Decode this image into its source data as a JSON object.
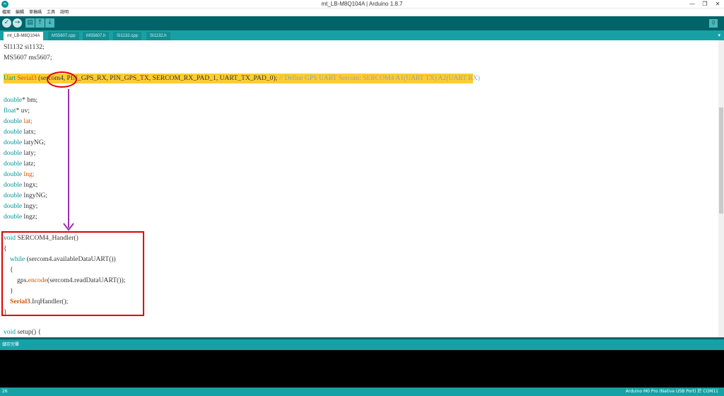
{
  "window": {
    "title": "mt_LB-M8Q104A | Arduino 1.8.7",
    "app_icon": "arduino-icon",
    "controls": {
      "minimize": "—",
      "restore": "❐",
      "close": "✕"
    }
  },
  "menu": [
    "檔案",
    "編輯",
    "草稿碼",
    "工具",
    "說明"
  ],
  "toolbar": {
    "verify_icon": "✓",
    "upload_icon": "→",
    "new_icon": "▤",
    "open_icon": "↑",
    "save_icon": "↓",
    "serial_monitor_icon": "⚲"
  },
  "tabs": [
    "mt_LB-M8Q104A",
    "MS5607.cpp",
    "MS5607.h",
    "SI1132.cpp",
    "SI1132.h"
  ],
  "tab_menu_icon": "▾",
  "code": {
    "line1": {
      "type": "SI1132",
      "rest": " si1132;"
    },
    "line2": {
      "type": "MS5607",
      "rest": " ms5607;"
    },
    "uart": {
      "t1": "Uart ",
      "t2": "Serial3",
      "t3": " (sercom4, PIN_GPS_RX, PIN_GPS_TX, SERCOM_RX_PAD_1, UART_TX_PAD_0); ",
      "t4": "// Define GPS UART Sercom: SERCOM4 A1(UART TX) A2(UART RX)"
    },
    "decls": [
      {
        "kw": "double",
        "name": "* bm;"
      },
      {
        "kw": "float",
        "name": "* uv;"
      },
      {
        "kw": "double",
        "name": " lat;",
        "highlight": true
      },
      {
        "kw": "double",
        "name": " latx;"
      },
      {
        "kw": "double",
        "name": " latyNG;"
      },
      {
        "kw": "double",
        "name": " laty;"
      },
      {
        "kw": "double",
        "name": " latz;"
      },
      {
        "kw": "double",
        "name": " lng;",
        "highlight": true
      },
      {
        "kw": "double",
        "name": " lngx;"
      },
      {
        "kw": "double",
        "name": " lngyNG;"
      },
      {
        "kw": "double",
        "name": " lngy;"
      },
      {
        "kw": "double",
        "name": " lngz;"
      }
    ],
    "handler": {
      "l1_kw": "void",
      "l1_rest": " SERCOM4_Handler()",
      "l2": "{",
      "l3_kw": "while",
      "l3_rest": " (sercom4.availableDataUART())",
      "l4": "{",
      "l5_a": "gps.",
      "l5_fn": "encode",
      "l5_b": "(sercom4.readDataUART());",
      "l6": "}",
      "l7_a": "Serial3",
      "l7_b": ".IrqHandler();",
      "l8": "}"
    },
    "setup": {
      "kw": "void",
      "name": " setup",
      "rest": "() {"
    }
  },
  "status": {
    "message": "儲存完畢"
  },
  "footer": {
    "line": "26",
    "board": "Arduino M0 Pro (Native USB Port) 於 COM11"
  },
  "colors": {
    "teal_dark": "#006468",
    "teal": "#17a1a5",
    "keyword": "#00979c",
    "function": "#d35400",
    "comment": "#95a5a6",
    "highlight": "#ffcc33",
    "annotation_red": "#e00000",
    "annotation_arrow": "#9b30b0"
  }
}
